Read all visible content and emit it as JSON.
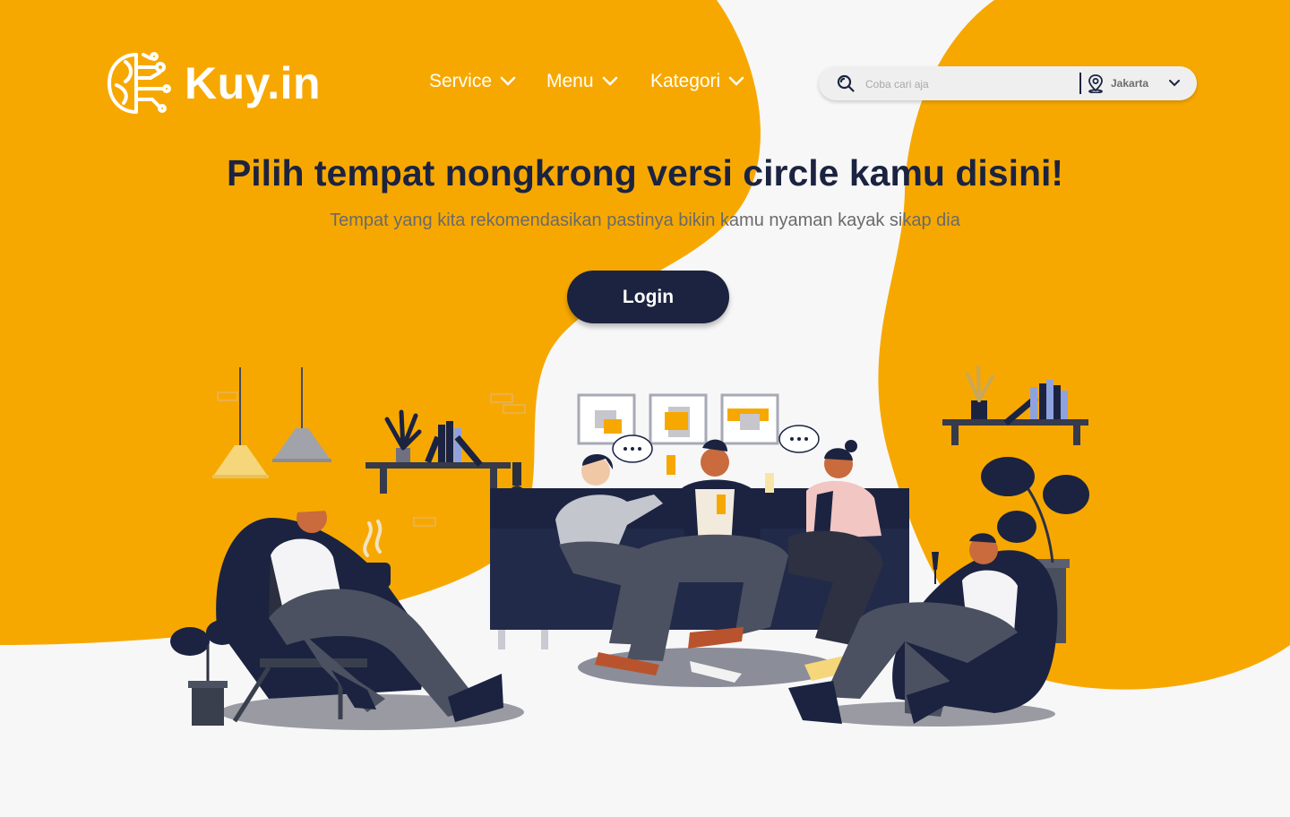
{
  "brand": {
    "name": "Kuy.in",
    "logo_icon": "circuit-brain-icon"
  },
  "nav": {
    "items": [
      {
        "label": "Service",
        "icon": "chevron-down-icon"
      },
      {
        "label": "Menu",
        "icon": "chevron-down-icon"
      },
      {
        "label": "Kategori",
        "icon": "chevron-down-icon"
      }
    ]
  },
  "search": {
    "placeholder": "Coba cari aja",
    "value": "",
    "location": "Jakarta"
  },
  "hero": {
    "title": "Pilih tempat nongkrong versi circle kamu disini!",
    "subtitle": "Tempat yang kita rekomendasikan pastinya bikin kamu nyaman kayak sikap dia",
    "cta_label": "Login"
  },
  "colors": {
    "accent": "#f7a800",
    "navy": "#1b2340",
    "background": "#f7f7f8"
  }
}
